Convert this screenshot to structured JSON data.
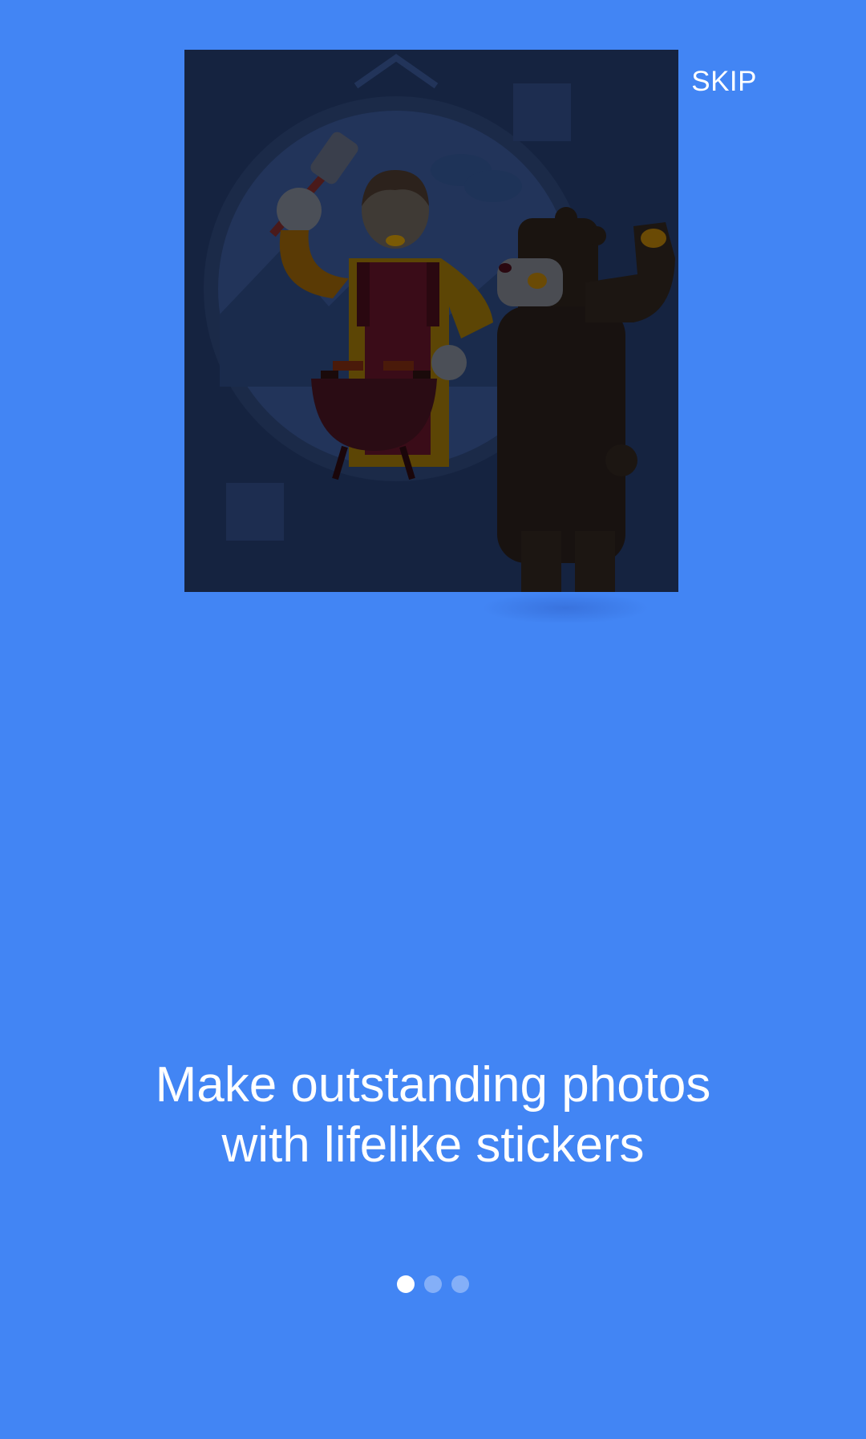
{
  "header": {
    "skip_label": "SKIP"
  },
  "onboarding": {
    "headline": "Make outstanding photos with lifelike stickers",
    "page_count": 3,
    "active_page": 1
  },
  "colors": {
    "background": "#4285f4",
    "illustration_bg": "#152340",
    "dot_active": "#ffffff",
    "dot_inactive": "rgba(255,255,255,0.35)"
  },
  "icons": {
    "illustration": "bbq-person-and-bear-illustration"
  }
}
